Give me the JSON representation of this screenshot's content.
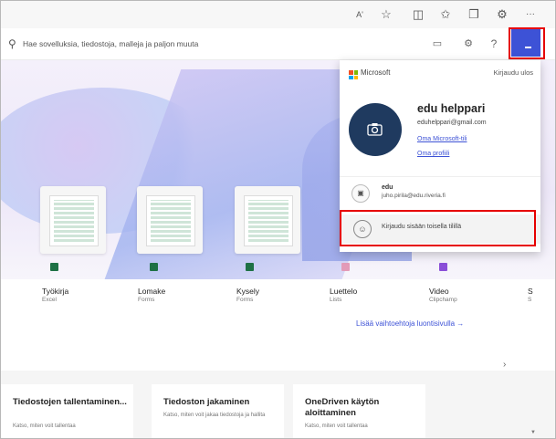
{
  "browser": {
    "icons": [
      "read-aloud-icon",
      "favorite-star-icon",
      "split-screen-icon",
      "favorites-icon",
      "collections-icon",
      "extensions-icon",
      "more-icon"
    ],
    "read_aloud_glyph": "Aʹ",
    "more_glyph": "···"
  },
  "header": {
    "search_placeholder": "Hae sovelluksia, tiedostoja, malleja ja paljon muuta",
    "accent": "#3d52d6"
  },
  "tiles": [
    {
      "name": "Työkirja",
      "app": "Excel",
      "color": "#1e7145"
    },
    {
      "name": "Lomake",
      "app": "Forms",
      "color": "#1e7145"
    },
    {
      "name": "Kysely",
      "app": "Forms",
      "color": "#1e7145"
    },
    {
      "name": "Luettelo",
      "app": "Lists",
      "color": "#e39bb8"
    },
    {
      "name": "Video",
      "app": "Clipchamp",
      "color": "#8a4fd8"
    },
    {
      "name": "S",
      "app": "S"
    }
  ],
  "more_options_link": "Lisää vaihtoehtoja luontisivulla →",
  "tips": [
    {
      "title": "Tiedostojen tallentaminen...",
      "sub": "Katso, miten voit tallentaa"
    },
    {
      "title": "Tiedoston jakaminen",
      "sub": "Katso, miten voit jakaa tiedostoja ja hallita"
    },
    {
      "title": "OneDriven käytön aloittaminen",
      "sub": "Katso, miten voit tallentaa"
    }
  ],
  "account": {
    "brand": "Microsoft",
    "sign_out": "Kirjaudu ulos",
    "name": "edu helppari",
    "email": "eduhelppari@gmail.com",
    "link_account": "Oma Microsoft-tili",
    "link_profile": "Oma profiili",
    "other_account_name": "edu",
    "other_account_email": "juho.pirila@edu.riveria.fi",
    "sign_in_other": "Kirjaudu sisään toisella tilillä"
  }
}
